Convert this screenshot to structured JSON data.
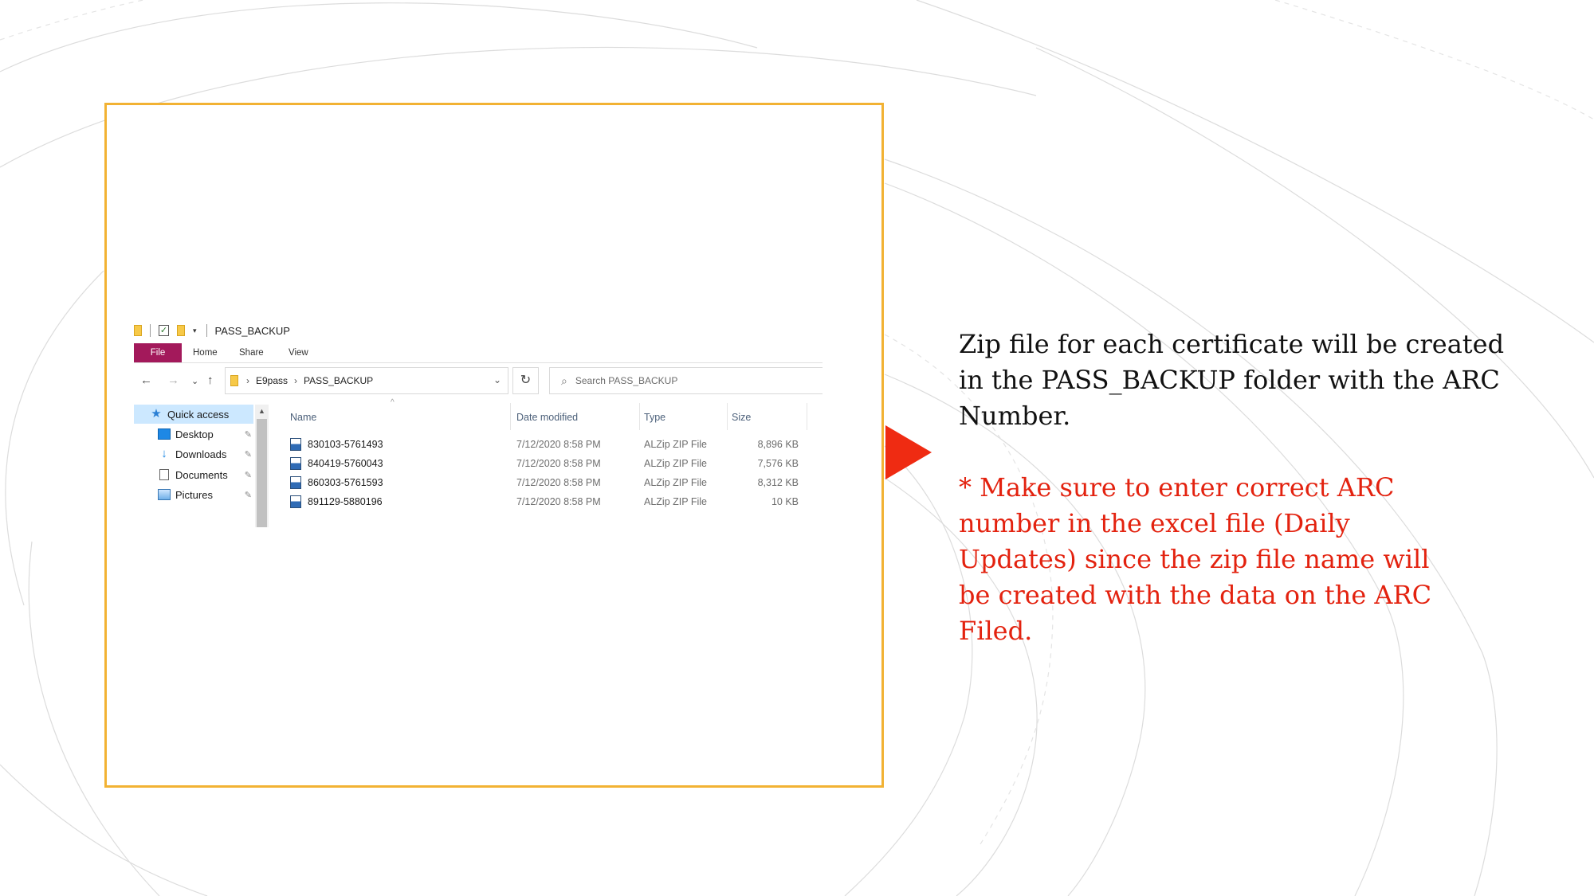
{
  "explorer": {
    "window_title": "PASS_BACKUP",
    "ribbon_tabs": [
      "File",
      "Home",
      "Share",
      "View"
    ],
    "address": {
      "root": "E9pass",
      "current": "PASS_BACKUP"
    },
    "search_placeholder": "Search PASS_BACKUP",
    "nav_items": [
      {
        "label": "Quick access",
        "icon": "star-icon",
        "selected": true
      },
      {
        "label": "Desktop",
        "icon": "desktop-icon"
      },
      {
        "label": "Downloads",
        "icon": "download-icon"
      },
      {
        "label": "Documents",
        "icon": "documents-icon"
      },
      {
        "label": "Pictures",
        "icon": "pictures-icon"
      }
    ],
    "columns": [
      "Name",
      "Date modified",
      "Type",
      "Size"
    ],
    "files": [
      {
        "name": "830103-5761493",
        "date": "7/12/2020 8:58 PM",
        "type": "ALZip ZIP File",
        "size": "8,896 KB"
      },
      {
        "name": "840419-5760043",
        "date": "7/12/2020 8:58 PM",
        "type": "ALZip ZIP File",
        "size": "7,576 KB"
      },
      {
        "name": "860303-5761593",
        "date": "7/12/2020 8:58 PM",
        "type": "ALZip ZIP File",
        "size": "8,312 KB"
      },
      {
        "name": "891129-5880196",
        "date": "7/12/2020 8:58 PM",
        "type": "ALZip ZIP File",
        "size": "10 KB"
      }
    ]
  },
  "slide": {
    "main_text": "Zip file for each certificate will be created in the PASS_BACKUP folder with the ARC Number.",
    "warning_text": "* Make sure to enter correct ARC number in the excel file (Daily Updates) since the zip file name will be created with the data on the ARC Filed."
  },
  "colors": {
    "frame": "#f2b233",
    "arrow": "#ef2b12",
    "warning": "#e3220f",
    "file_tab": "#a3195b"
  }
}
